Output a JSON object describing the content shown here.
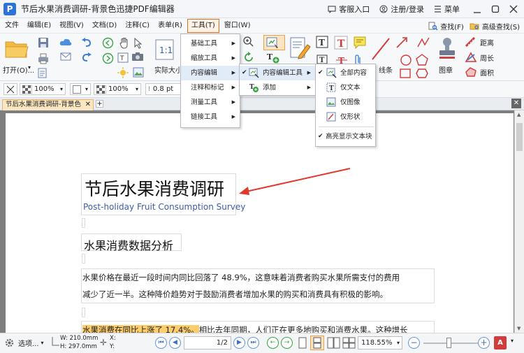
{
  "window": {
    "title": "节后水果消费调研-背景色迅捷PDF编辑器",
    "logo_letter": "P",
    "support": "客服入口",
    "login": "注册/登录",
    "menu": "菜单"
  },
  "menubar": {
    "items": [
      "文件",
      "编辑(E)",
      "视图(V)",
      "文档(D)",
      "注释(C)",
      "表单(R)",
      "工具(T)",
      "窗口(W)"
    ],
    "active_index": 6,
    "find": "查找(F)",
    "advanced_find": "高级查找(S)"
  },
  "ribbon": {
    "open_label": "打开(O)...",
    "actual_size_label": "实际大小",
    "line_label": "线条",
    "stamp_label": "图章",
    "distance_label": "距离",
    "perimeter_label": "周长",
    "area_label": "面积"
  },
  "propsbar": {
    "opacity1": "100%",
    "opacity2": "100%",
    "line_width": "0.8 pt"
  },
  "tabs": {
    "doc_tab": "节后水果消费调研-背景色"
  },
  "tools_menu": {
    "items": [
      "基础工具",
      "缩放工具",
      "内容编辑",
      "注释和标记",
      "测量工具",
      "链接工具"
    ],
    "selected_index": 2
  },
  "content_edit_menu": {
    "items": [
      "内容编辑工具",
      "添加"
    ]
  },
  "content_tools_menu": {
    "items": [
      "全部内容",
      "仅文本",
      "仅图像",
      "仅形状"
    ],
    "checked_index": 0,
    "highlight_label": "高亮显示文本块"
  },
  "document": {
    "title_cn": "节后水果消费调研",
    "title_en": "Post-holiday Fruit Consumption Survey",
    "heading": "水果消费数据分析",
    "para1_line1": "水果价格在最近一段时间内同比回落了  48.9%，这意味着消费者购买水果所需支付的费用",
    "para1_line2": "减少了近一半。这种降价趋势对于鼓励消费者增加水果的购买和消费具有积极的影响。",
    "para2_highlight": "水果消费在同比上涨了 17.4%。",
    "para2_rest": "相比去年同期，人们正在更多地购买和消费水果。这种增长"
  },
  "statusbar": {
    "options": "选项...",
    "width": "W: 210.0mm",
    "height": "H: 297.0mm",
    "x": "X:",
    "y": "Y:",
    "page_current": "1",
    "page_total": "/2",
    "zoom": "118.55%"
  },
  "colors": {
    "accent_orange": "#e26f1d",
    "highlight": "#fccd6b",
    "arrow": "#e03a2f",
    "logo_blue": "#2e73d8"
  }
}
